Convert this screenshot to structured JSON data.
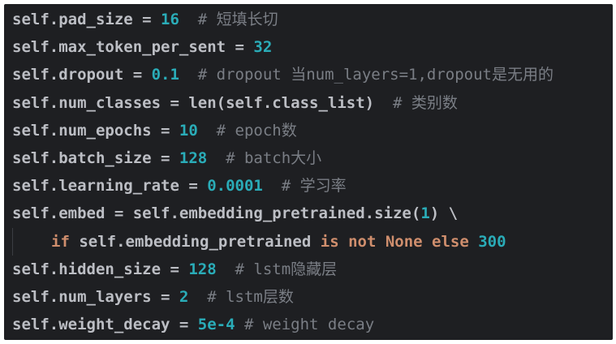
{
  "code_lines": [
    {
      "code": "self.pad_size = ",
      "num": "16",
      "comment": "  # 短填长切"
    },
    {
      "code": "self.max_token_per_sent = ",
      "num": "32",
      "comment": ""
    },
    {
      "code": "self.dropout = ",
      "num": "0.1",
      "comment": "  # dropout 当num_layers=1,dropout是无用的"
    },
    {
      "code": "self.num_classes = len(self.class_list)",
      "num": "",
      "comment": "  # 类别数"
    },
    {
      "code": "self.num_epochs = ",
      "num": "10",
      "comment": "  # epoch数"
    },
    {
      "code": "self.batch_size = ",
      "num": "128",
      "comment": "  # batch大小"
    },
    {
      "code": "self.learning_rate = ",
      "num": "0.0001",
      "comment": "  # 学习率"
    },
    {
      "code": "self.embed = self.embedding_pretrained.size(",
      "num": "1",
      "code_after": ") \\"
    },
    {
      "kw_if": "if",
      "code_mid": " self.embedding_pretrained ",
      "kw_is_not_none_else": "is not None else",
      "num": " 300"
    },
    {
      "code": "self.hidden_size = ",
      "num": "128",
      "comment": "  # lstm隐藏层"
    },
    {
      "code": "self.num_layers = ",
      "num": "2",
      "comment": "  # lstm层数"
    },
    {
      "code": "self.weight_decay = ",
      "num": "5e-4",
      "comment": " # weight decay"
    }
  ]
}
